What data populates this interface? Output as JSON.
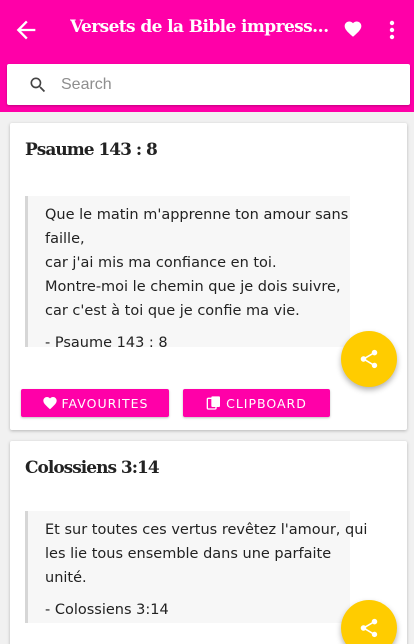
{
  "appbar": {
    "title": "Versets de la Bible impressionnants",
    "back_icon": "arrow-back-icon",
    "favorite_icon": "heart-icon",
    "menu_icon": "more-vert-icon"
  },
  "search": {
    "placeholder": "Search",
    "value": "",
    "icon": "search-icon"
  },
  "cards": [
    {
      "reference": "Psaume 143 : 8",
      "lines": [
        "Que le matin m'apprenne ton amour sans",
        "faille,",
        "car j'ai mis ma confiance en toi.",
        "Montre-moi le chemin que je dois suivre,",
        "car c'est à toi que je confie ma vie."
      ],
      "citation": "- Psaume 143 : 8"
    },
    {
      "reference": "Colossiens 3:14",
      "lines": [
        "Et sur toutes ces vertus revêtez l'amour, qui",
        "les lie tous ensemble dans une parfaite",
        "unité."
      ],
      "citation": "- Colossiens 3:14"
    }
  ],
  "buttons": {
    "favourites": "FAVOURITES",
    "clipboard": "CLIPBOARD"
  },
  "colors": {
    "primary": "#ff00a8",
    "fab": "#ffcc00",
    "background": "#f1f1f1"
  }
}
